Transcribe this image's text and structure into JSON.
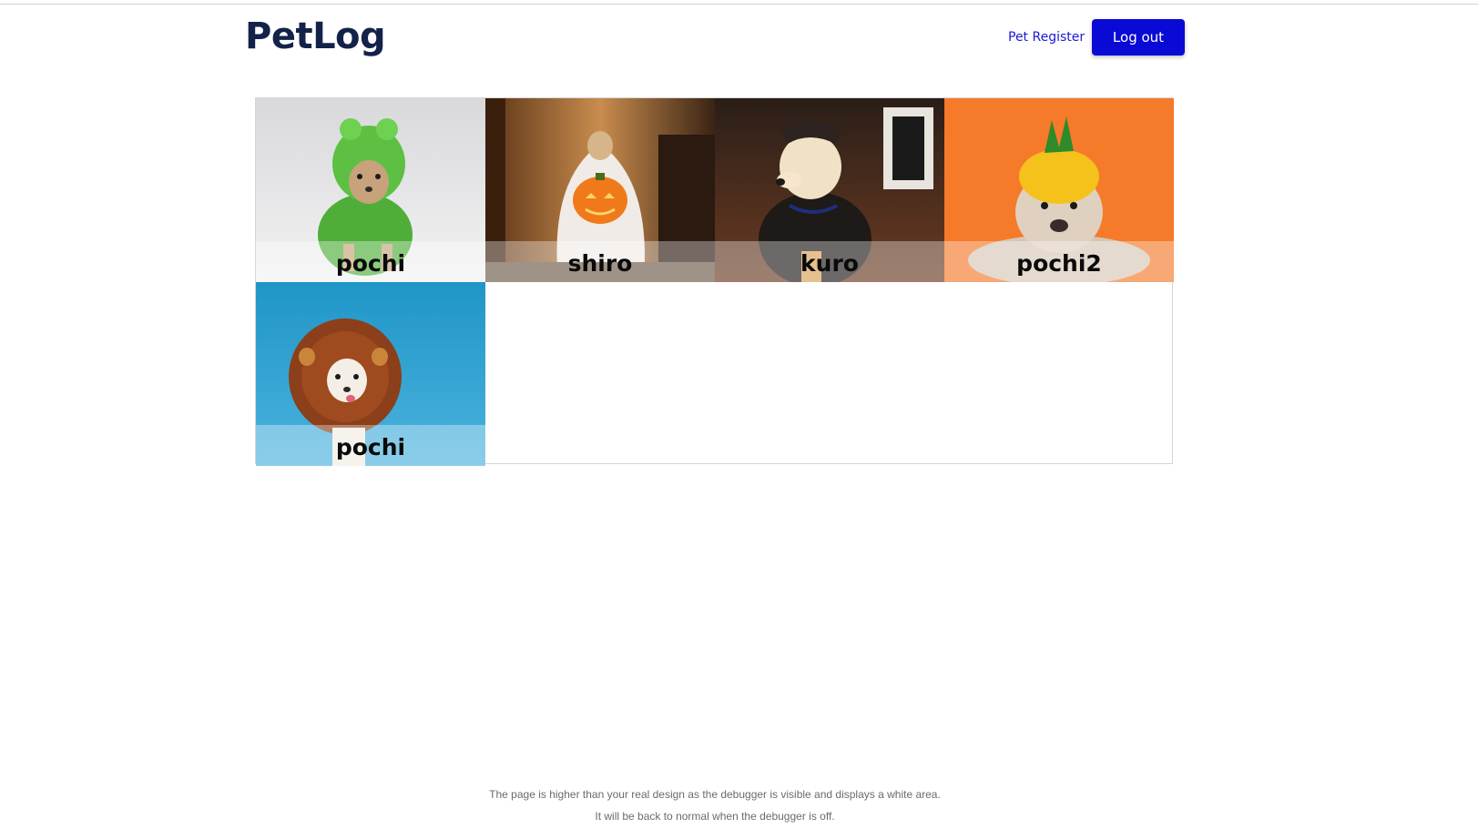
{
  "app": {
    "title": "PetLog"
  },
  "nav": {
    "pet_register": "Pet Register",
    "logout": "Log out"
  },
  "colors": {
    "brand": "#14224a",
    "primary": "#0a0ad6",
    "link": "#1a1ad0"
  },
  "pets": [
    {
      "name": "pochi",
      "photo": "chihuahua-frog-costume"
    },
    {
      "name": "shiro",
      "photo": "dog-ghost-costume-pumpkin-bucket"
    },
    {
      "name": "kuro",
      "photo": "labrador-ups-costume"
    },
    {
      "name": "pochi2",
      "photo": "bulldog-pineapple-hat"
    },
    {
      "name": "pochi",
      "photo": "chihuahua-lion-mane"
    }
  ],
  "debugger_note": {
    "line1": "The page is higher than your real design as the debugger is visible and displays a white area.",
    "line2": "It will be back to normal when the debugger is off."
  }
}
